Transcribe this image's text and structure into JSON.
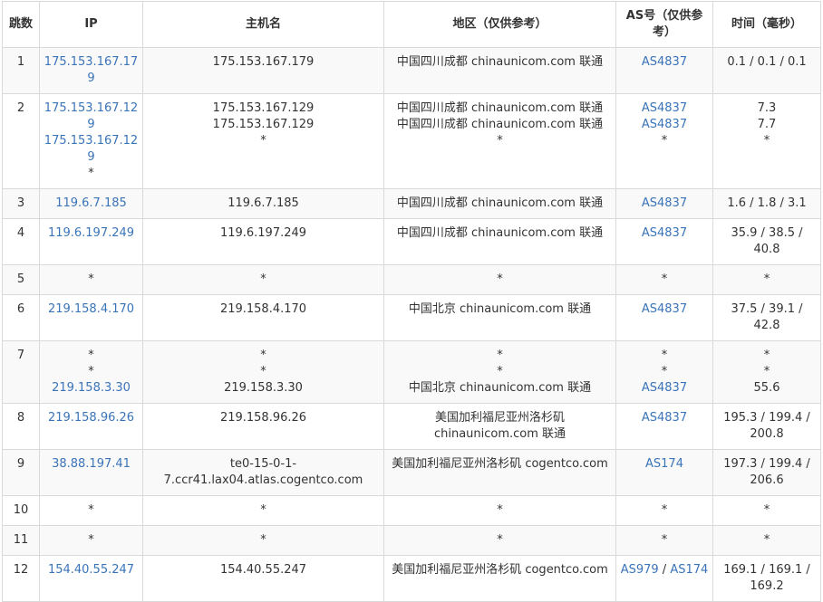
{
  "headers": {
    "hop": "跳数",
    "ip": "IP",
    "host": "主机名",
    "geo": "地区（仅供参考）",
    "as": "AS号（仅供参考）",
    "time": "时间（毫秒）"
  },
  "rows": [
    {
      "hop": "1",
      "ips": [
        "175.153.167.179"
      ],
      "hosts": [
        "175.153.167.179"
      ],
      "geos": [
        "中国四川成都 chinaunicom.com 联通"
      ],
      "as": [
        [
          "AS4837"
        ]
      ],
      "times": [
        "0.1 / 0.1 / 0.1"
      ]
    },
    {
      "hop": "2",
      "ips": [
        "175.153.167.129",
        "175.153.167.129",
        "*"
      ],
      "hosts": [
        "175.153.167.129",
        "175.153.167.129",
        "*"
      ],
      "geos": [
        "中国四川成都 chinaunicom.com 联通",
        "中国四川成都 chinaunicom.com 联通",
        "*"
      ],
      "as": [
        [
          "AS4837"
        ],
        [
          "AS4837"
        ],
        [
          "*"
        ]
      ],
      "times": [
        "7.3",
        "7.7",
        "*"
      ]
    },
    {
      "hop": "3",
      "ips": [
        "119.6.7.185"
      ],
      "hosts": [
        "119.6.7.185"
      ],
      "geos": [
        "中国四川成都 chinaunicom.com 联通"
      ],
      "as": [
        [
          "AS4837"
        ]
      ],
      "times": [
        "1.6 / 1.8 / 3.1"
      ]
    },
    {
      "hop": "4",
      "ips": [
        "119.6.197.249"
      ],
      "hosts": [
        "119.6.197.249"
      ],
      "geos": [
        "中国四川成都 chinaunicom.com 联通"
      ],
      "as": [
        [
          "AS4837"
        ]
      ],
      "times": [
        "35.9 / 38.5 / 40.8"
      ]
    },
    {
      "hop": "5",
      "ips": [
        "*"
      ],
      "hosts": [
        "*"
      ],
      "geos": [
        "*"
      ],
      "as": [
        [
          "*"
        ]
      ],
      "times": [
        "*"
      ]
    },
    {
      "hop": "6",
      "ips": [
        "219.158.4.170"
      ],
      "hosts": [
        "219.158.4.170"
      ],
      "geos": [
        "中国北京 chinaunicom.com 联通"
      ],
      "as": [
        [
          "AS4837"
        ]
      ],
      "times": [
        "37.5 / 39.1 / 42.8"
      ]
    },
    {
      "hop": "7",
      "ips": [
        "*",
        "*",
        "219.158.3.30"
      ],
      "hosts": [
        "*",
        "*",
        "219.158.3.30"
      ],
      "geos": [
        "*",
        "*",
        "中国北京 chinaunicom.com 联通"
      ],
      "as": [
        [
          "*"
        ],
        [
          "*"
        ],
        [
          "AS4837"
        ]
      ],
      "times": [
        "*",
        "*",
        "55.6"
      ]
    },
    {
      "hop": "8",
      "ips": [
        "219.158.96.26"
      ],
      "hosts": [
        "219.158.96.26"
      ],
      "geos": [
        "美国加利福尼亚州洛杉矶 chinaunicom.com 联通"
      ],
      "as": [
        [
          "AS4837"
        ]
      ],
      "times": [
        "195.3 / 199.4 / 200.8"
      ]
    },
    {
      "hop": "9",
      "ips": [
        "38.88.197.41"
      ],
      "hosts": [
        "te0-15-0-1-7.ccr41.lax04.atlas.cogentco.com"
      ],
      "geos": [
        "美国加利福尼亚州洛杉矶 cogentco.com"
      ],
      "as": [
        [
          "AS174"
        ]
      ],
      "times": [
        "197.3 / 199.4 / 206.6"
      ]
    },
    {
      "hop": "10",
      "ips": [
        "*"
      ],
      "hosts": [
        "*"
      ],
      "geos": [
        "*"
      ],
      "as": [
        [
          "*"
        ]
      ],
      "times": [
        "*"
      ]
    },
    {
      "hop": "11",
      "ips": [
        "*"
      ],
      "hosts": [
        "*"
      ],
      "geos": [
        "*"
      ],
      "as": [
        [
          "*"
        ]
      ],
      "times": [
        "*"
      ]
    },
    {
      "hop": "12",
      "ips": [
        "154.40.55.247"
      ],
      "hosts": [
        "154.40.55.247"
      ],
      "geos": [
        "美国加利福尼亚州洛杉矶 cogentco.com"
      ],
      "as": [
        [
          "AS979",
          "AS174"
        ]
      ],
      "times": [
        "169.1 / 169.1 / 169.2"
      ]
    }
  ],
  "as_separator": " / ",
  "colors": {
    "link": "#3a74b8",
    "stripe": "#f9f9f9",
    "border": "#d9d9d9"
  }
}
